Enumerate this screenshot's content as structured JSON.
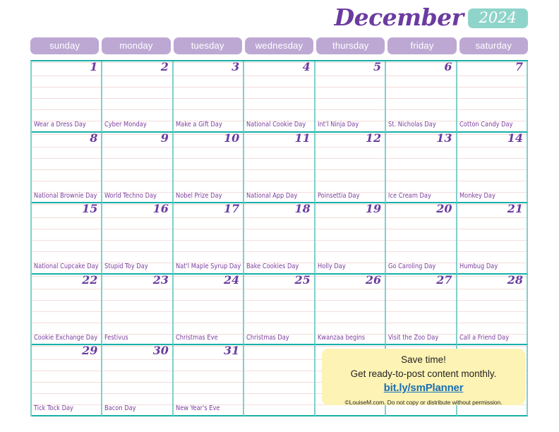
{
  "header": {
    "month": "December",
    "year": "2024",
    "month_color": "#6b3ba0",
    "year_badge_color": "#8fd4ca"
  },
  "weekdays": [
    {
      "label": "sunday"
    },
    {
      "label": "monday"
    },
    {
      "label": "tuesday"
    },
    {
      "label": "wednesday"
    },
    {
      "label": "thursday"
    },
    {
      "label": "friday"
    },
    {
      "label": "saturday"
    }
  ],
  "colors": {
    "pill": "#bda8d4",
    "grid_major": "#17b0a8",
    "grid_minor": "#7fd0cb",
    "rule_line": "#f5dcdc",
    "date_text": "#6b3ba0",
    "event_text": "#7b3f9d",
    "promo_bg": "#fdf3b4",
    "promo_link": "#1a6fb5"
  },
  "cells": [
    {
      "day": "1",
      "event": "Wear a Dress Day"
    },
    {
      "day": "2",
      "event": "Cyber Monday"
    },
    {
      "day": "3",
      "event": "Make a Gift Day"
    },
    {
      "day": "4",
      "event": "National Cookie Day"
    },
    {
      "day": "5",
      "event": "Int'l Ninja Day"
    },
    {
      "day": "6",
      "event": "St. Nicholas Day"
    },
    {
      "day": "7",
      "event": "Cotton Candy Day"
    },
    {
      "day": "8",
      "event": "National Brownie Day"
    },
    {
      "day": "9",
      "event": "World Techno Day"
    },
    {
      "day": "10",
      "event": "Nobel Prize Day"
    },
    {
      "day": "11",
      "event": "National App Day"
    },
    {
      "day": "12",
      "event": "Poinsettia Day"
    },
    {
      "day": "13",
      "event": "Ice Cream Day"
    },
    {
      "day": "14",
      "event": "Monkey Day"
    },
    {
      "day": "15",
      "event": "National Cupcake Day"
    },
    {
      "day": "16",
      "event": "Stupid Toy Day"
    },
    {
      "day": "17",
      "event": "Nat'l Maple Syrup Day"
    },
    {
      "day": "18",
      "event": "Bake Cookies Day"
    },
    {
      "day": "19",
      "event": "Holly Day"
    },
    {
      "day": "20",
      "event": "Go Caroling Day"
    },
    {
      "day": "21",
      "event": "Humbug Day"
    },
    {
      "day": "22",
      "event": "Cookie Exchange Day"
    },
    {
      "day": "23",
      "event": "Festivus"
    },
    {
      "day": "24",
      "event": "Christmas Eve"
    },
    {
      "day": "25",
      "event": "Christmas Day"
    },
    {
      "day": "26",
      "event": "Kwanzaa begins"
    },
    {
      "day": "27",
      "event": "Visit the Zoo Day"
    },
    {
      "day": "28",
      "event": "Call a Friend Day"
    },
    {
      "day": "29",
      "event": "Tick Tock Day"
    },
    {
      "day": "30",
      "event": "Bacon Day"
    },
    {
      "day": "31",
      "event": "New Year's Eve"
    },
    {
      "day": "",
      "event": ""
    },
    {
      "day": "",
      "event": ""
    },
    {
      "day": "",
      "event": ""
    },
    {
      "day": "",
      "event": ""
    }
  ],
  "promo": {
    "line1": "Save time!",
    "line2": "Get ready-to-post content monthly.",
    "link": "bit.ly/smPlanner",
    "copyright": "©LouiseM.com. Do not copy or distribute without permission."
  }
}
